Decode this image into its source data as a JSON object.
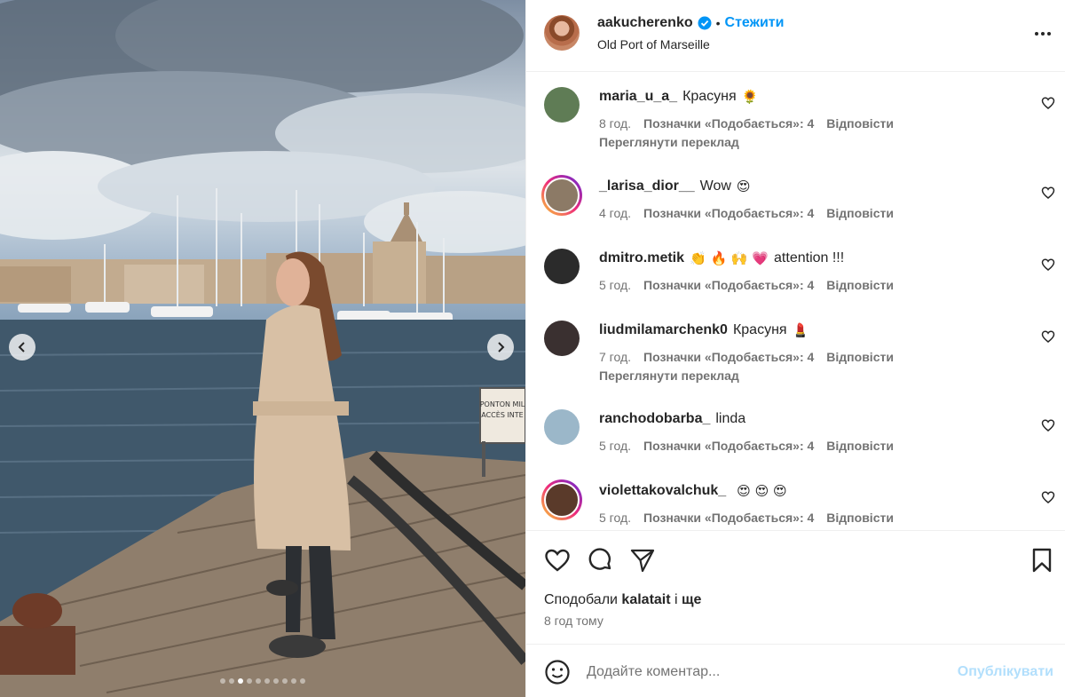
{
  "post": {
    "author": "aakucherenko",
    "verified": true,
    "follow_label": "Стежити",
    "separator": "•",
    "location": "Old Port of Marseille",
    "more_icon": "more-horizontal-icon"
  },
  "media": {
    "sign_lines": [
      "PONTON MIL",
      "ACCÈS INTE"
    ],
    "carousel": {
      "count": 10,
      "active_index": 2
    },
    "prev_icon": "chevron-left-icon",
    "next_icon": "chevron-right-icon"
  },
  "comments": [
    {
      "user": "maria_u_a_",
      "text": "Красуня",
      "emoji": "🌻",
      "time": "8 год.",
      "likes": "Позначки «Подобається»: 4",
      "reply": "Відповісти",
      "translate": "Переглянути переклад",
      "ring": false,
      "avatar_color": "#5f7c55"
    },
    {
      "user": "_larisa_dior__",
      "text": "Wow",
      "emoji": "😍",
      "time": "4 год.",
      "likes": "Позначки «Подобається»: 4",
      "reply": "Відповісти",
      "translate": "",
      "ring": true,
      "avatar_color": "#8c7a66"
    },
    {
      "user": "dmitro.metik",
      "text": "attention !!!",
      "emoji": "👏 🔥 🙌 💗",
      "time": "5 год.",
      "likes": "Позначки «Подобається»: 4",
      "reply": "Відповісти",
      "translate": "",
      "ring": false,
      "avatar_color": "#2b2b2b"
    },
    {
      "user": "liudmilamarchenk0",
      "text": "Красуня",
      "emoji": "💄",
      "time": "7 год.",
      "likes": "Позначки «Подобається»: 4",
      "reply": "Відповісти",
      "translate": "Переглянути переклад",
      "ring": false,
      "avatar_color": "#3a3030"
    },
    {
      "user": "ranchodobarba_",
      "text": "linda",
      "emoji": "",
      "time": "5 год.",
      "likes": "Позначки «Подобається»: 4",
      "reply": "Відповісти",
      "translate": "",
      "ring": false,
      "avatar_color": "#9bb7c9"
    },
    {
      "user": "violettakovalchuk_",
      "text": "",
      "emoji": "😍 😍 😍",
      "time": "5 год.",
      "likes": "Позначки «Подобається»: 4",
      "reply": "Відповісти",
      "translate": "",
      "ring": true,
      "avatar_color": "#5a3a2a"
    }
  ],
  "actions": {
    "like_icon": "heart-outline-icon",
    "comment_icon": "comment-bubble-icon",
    "share_icon": "send-paper-plane-icon",
    "save_icon": "bookmark-icon"
  },
  "likes_summary": {
    "prefix": "Сподобали",
    "user": "kalatait",
    "joiner": "і",
    "suffix": "ще"
  },
  "posted_time": "8 год тому",
  "composer": {
    "emoji_icon": "smiley-face-icon",
    "placeholder": "Додайте коментар...",
    "publish_label": "Опублікувати"
  },
  "colors": {
    "accent": "#0095f6",
    "publish_disabled": "#b2dffc",
    "secondary_text": "#737373",
    "verified_badge": "#0095f6"
  }
}
